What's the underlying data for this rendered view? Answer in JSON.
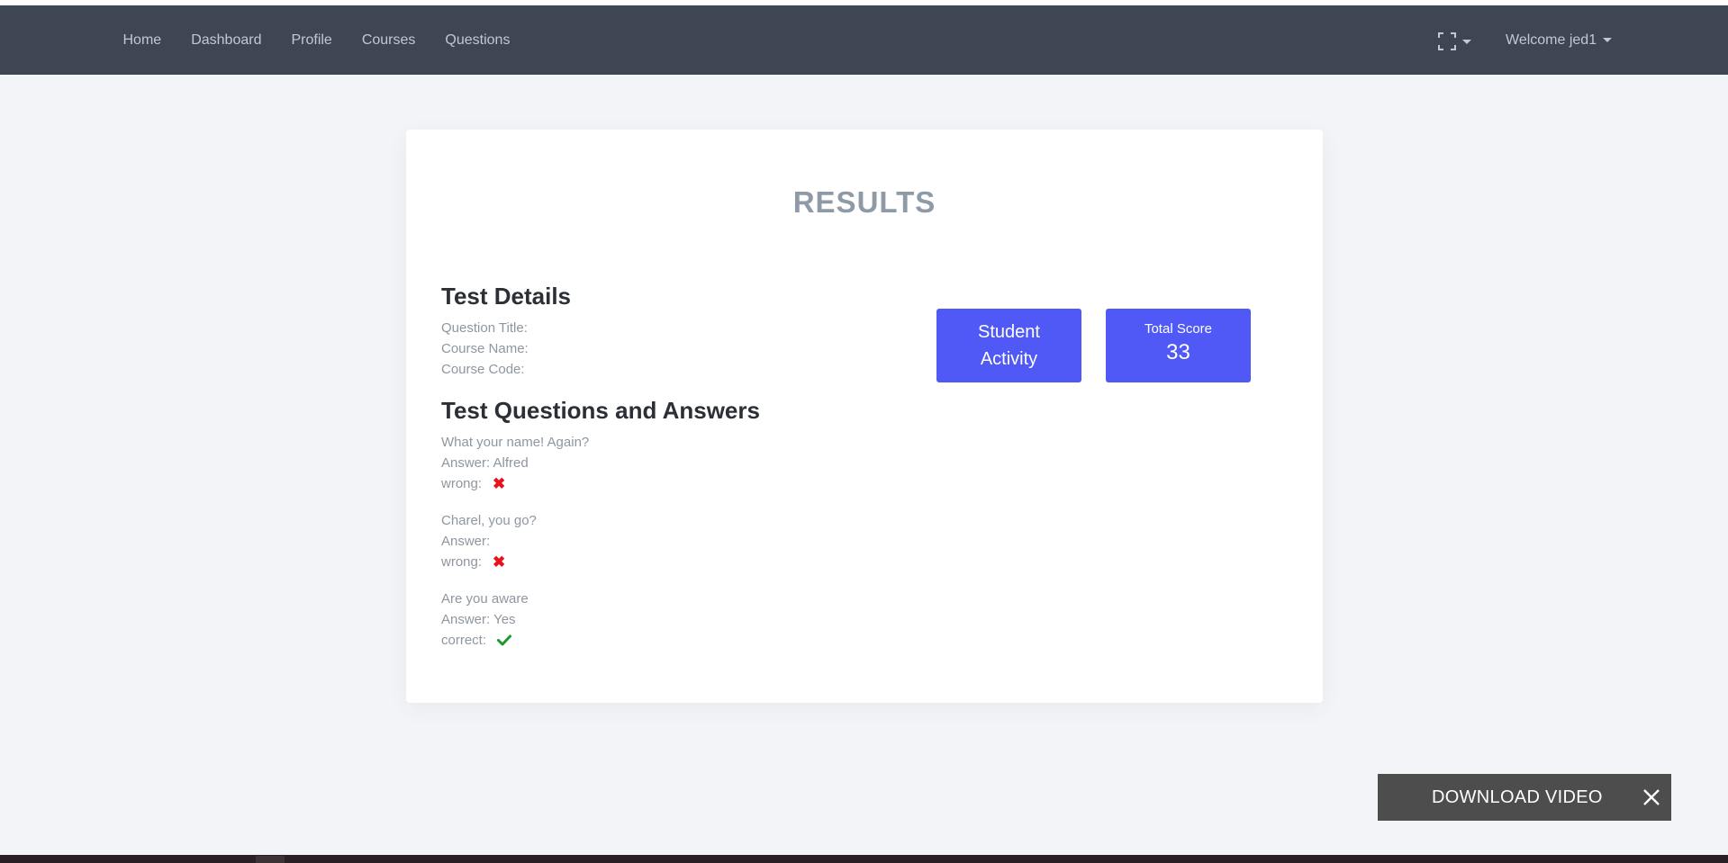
{
  "nav": {
    "links": [
      "Home",
      "Dashboard",
      "Profile",
      "Courses",
      "Questions"
    ],
    "welcome_label": "Welcome jed1",
    "fullscreen_icon": "fullscreen-icon"
  },
  "results": {
    "title": "RESULTS",
    "test_details_heading": "Test Details",
    "question_title_label": "Question Title:",
    "course_name_label": "Course Name:",
    "course_code_label": "Course Code:",
    "qa_heading": "Test Questions and Answers",
    "questions": [
      {
        "question": "What your name! Again?",
        "answer": "Answer: Alfred",
        "status": "wrong:",
        "mark": "✖"
      },
      {
        "question": "Charel, you go?",
        "answer": "Answer:",
        "status": "wrong:",
        "mark": "✖"
      },
      {
        "question": "Are you aware",
        "answer": "Answer: Yes",
        "status": "correct:",
        "mark": "check-icon"
      }
    ]
  },
  "stats": {
    "student_activity_line1": "Student",
    "student_activity_line2": "Activity",
    "total_score_label": "Total Score",
    "total_score_value": "33"
  },
  "download": {
    "label": "DOWNLOAD VIDEO"
  },
  "colors": {
    "navbar": "#3e4553",
    "accent": "#5059f5",
    "wrong": "#e8121b",
    "correct": "#1a9a2e"
  }
}
